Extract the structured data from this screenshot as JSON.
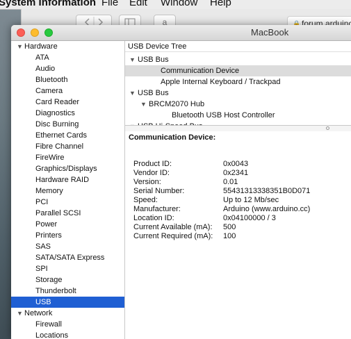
{
  "menubar": {
    "app_name": "System Information",
    "items": [
      "File",
      "Edit",
      "Window",
      "Help"
    ]
  },
  "browser": {
    "address": "forum.arduino.cc"
  },
  "window": {
    "title": "MacBook"
  },
  "sidebar": {
    "groups": [
      {
        "label": "Hardware",
        "items": [
          "ATA",
          "Audio",
          "Bluetooth",
          "Camera",
          "Card Reader",
          "Diagnostics",
          "Disc Burning",
          "Ethernet Cards",
          "Fibre Channel",
          "FireWire",
          "Graphics/Displays",
          "Hardware RAID",
          "Memory",
          "PCI",
          "Parallel SCSI",
          "Power",
          "Printers",
          "SAS",
          "SATA/SATA Express",
          "SPI",
          "Storage",
          "Thunderbolt",
          "USB"
        ]
      },
      {
        "label": "Network",
        "items": [
          "Firewall",
          "Locations"
        ]
      }
    ],
    "selected": "USB"
  },
  "device_tree": {
    "header": "USB Device Tree",
    "rows": [
      {
        "label": "USB Bus"
      },
      {
        "label": "Communication Device"
      },
      {
        "label": "Apple Internal Keyboard / Trackpad"
      },
      {
        "label": "USB Bus"
      },
      {
        "label": "BRCM2070 Hub"
      },
      {
        "label": "Bluetooth USB Host Controller"
      },
      {
        "label": "USB Hi-Speed Bus"
      }
    ],
    "selected_index": 1
  },
  "details": {
    "title": "Communication Device:",
    "properties": [
      {
        "key": "Product ID:",
        "value": "0x0043"
      },
      {
        "key": "Vendor ID:",
        "value": "0x2341"
      },
      {
        "key": "Version:",
        "value": "0.01"
      },
      {
        "key": "Serial Number:",
        "value": "55431313338351B0D071"
      },
      {
        "key": "Speed:",
        "value": "Up to 12 Mb/sec"
      },
      {
        "key": "Manufacturer:",
        "value": "Arduino (www.arduino.cc)"
      },
      {
        "key": "Location ID:",
        "value": "0x04100000 / 3"
      },
      {
        "key": "Current Available (mA):",
        "value": "500"
      },
      {
        "key": "Current Required (mA):",
        "value": "100"
      }
    ]
  }
}
